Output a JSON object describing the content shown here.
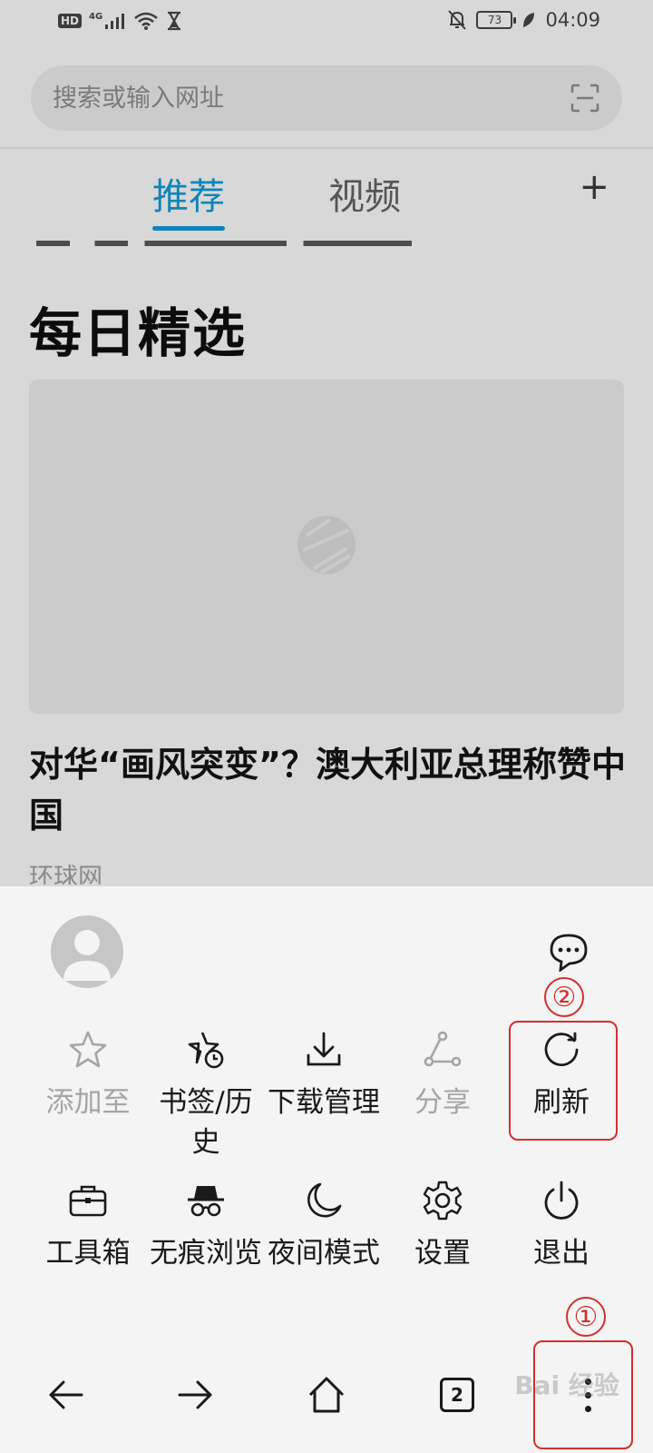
{
  "status_bar": {
    "hd": "HD",
    "network": "4G",
    "battery": "73",
    "time": "04:09"
  },
  "search": {
    "placeholder": "搜索或输入网址"
  },
  "tabs": [
    {
      "label": "推荐",
      "active": true
    },
    {
      "label": "视频",
      "active": false
    }
  ],
  "add_tab_label": "+",
  "section": {
    "title": "每日精选"
  },
  "article": {
    "headline": "对华“画风突变”？澳大利亚总理称赞中国",
    "source": "环球网"
  },
  "menu": {
    "items": [
      {
        "label": "添加至",
        "icon": "star-icon",
        "enabled": false
      },
      {
        "label": "书签/历史",
        "icon": "bookmark-history-icon",
        "enabled": true
      },
      {
        "label": "下载管理",
        "icon": "download-icon",
        "enabled": true
      },
      {
        "label": "分享",
        "icon": "share-icon",
        "enabled": false
      },
      {
        "label": "刷新",
        "icon": "refresh-icon",
        "enabled": true
      },
      {
        "label": "工具箱",
        "icon": "toolbox-icon",
        "enabled": true
      },
      {
        "label": "无痕浏览",
        "icon": "incognito-icon",
        "enabled": true
      },
      {
        "label": "夜间模式",
        "icon": "moon-icon",
        "enabled": true
      },
      {
        "label": "设置",
        "icon": "gear-icon",
        "enabled": true
      },
      {
        "label": "退出",
        "icon": "power-icon",
        "enabled": true
      }
    ]
  },
  "annotations": {
    "step1": "①",
    "step2": "②"
  },
  "bottom_nav": {
    "tab_count": "2"
  },
  "watermark": "Bai 经验",
  "colors": {
    "accent": "#0d85b8",
    "annotation": "#d32f2f",
    "overlay_bg": "#d8d8d8",
    "sheet_bg": "#f4f4f4"
  }
}
